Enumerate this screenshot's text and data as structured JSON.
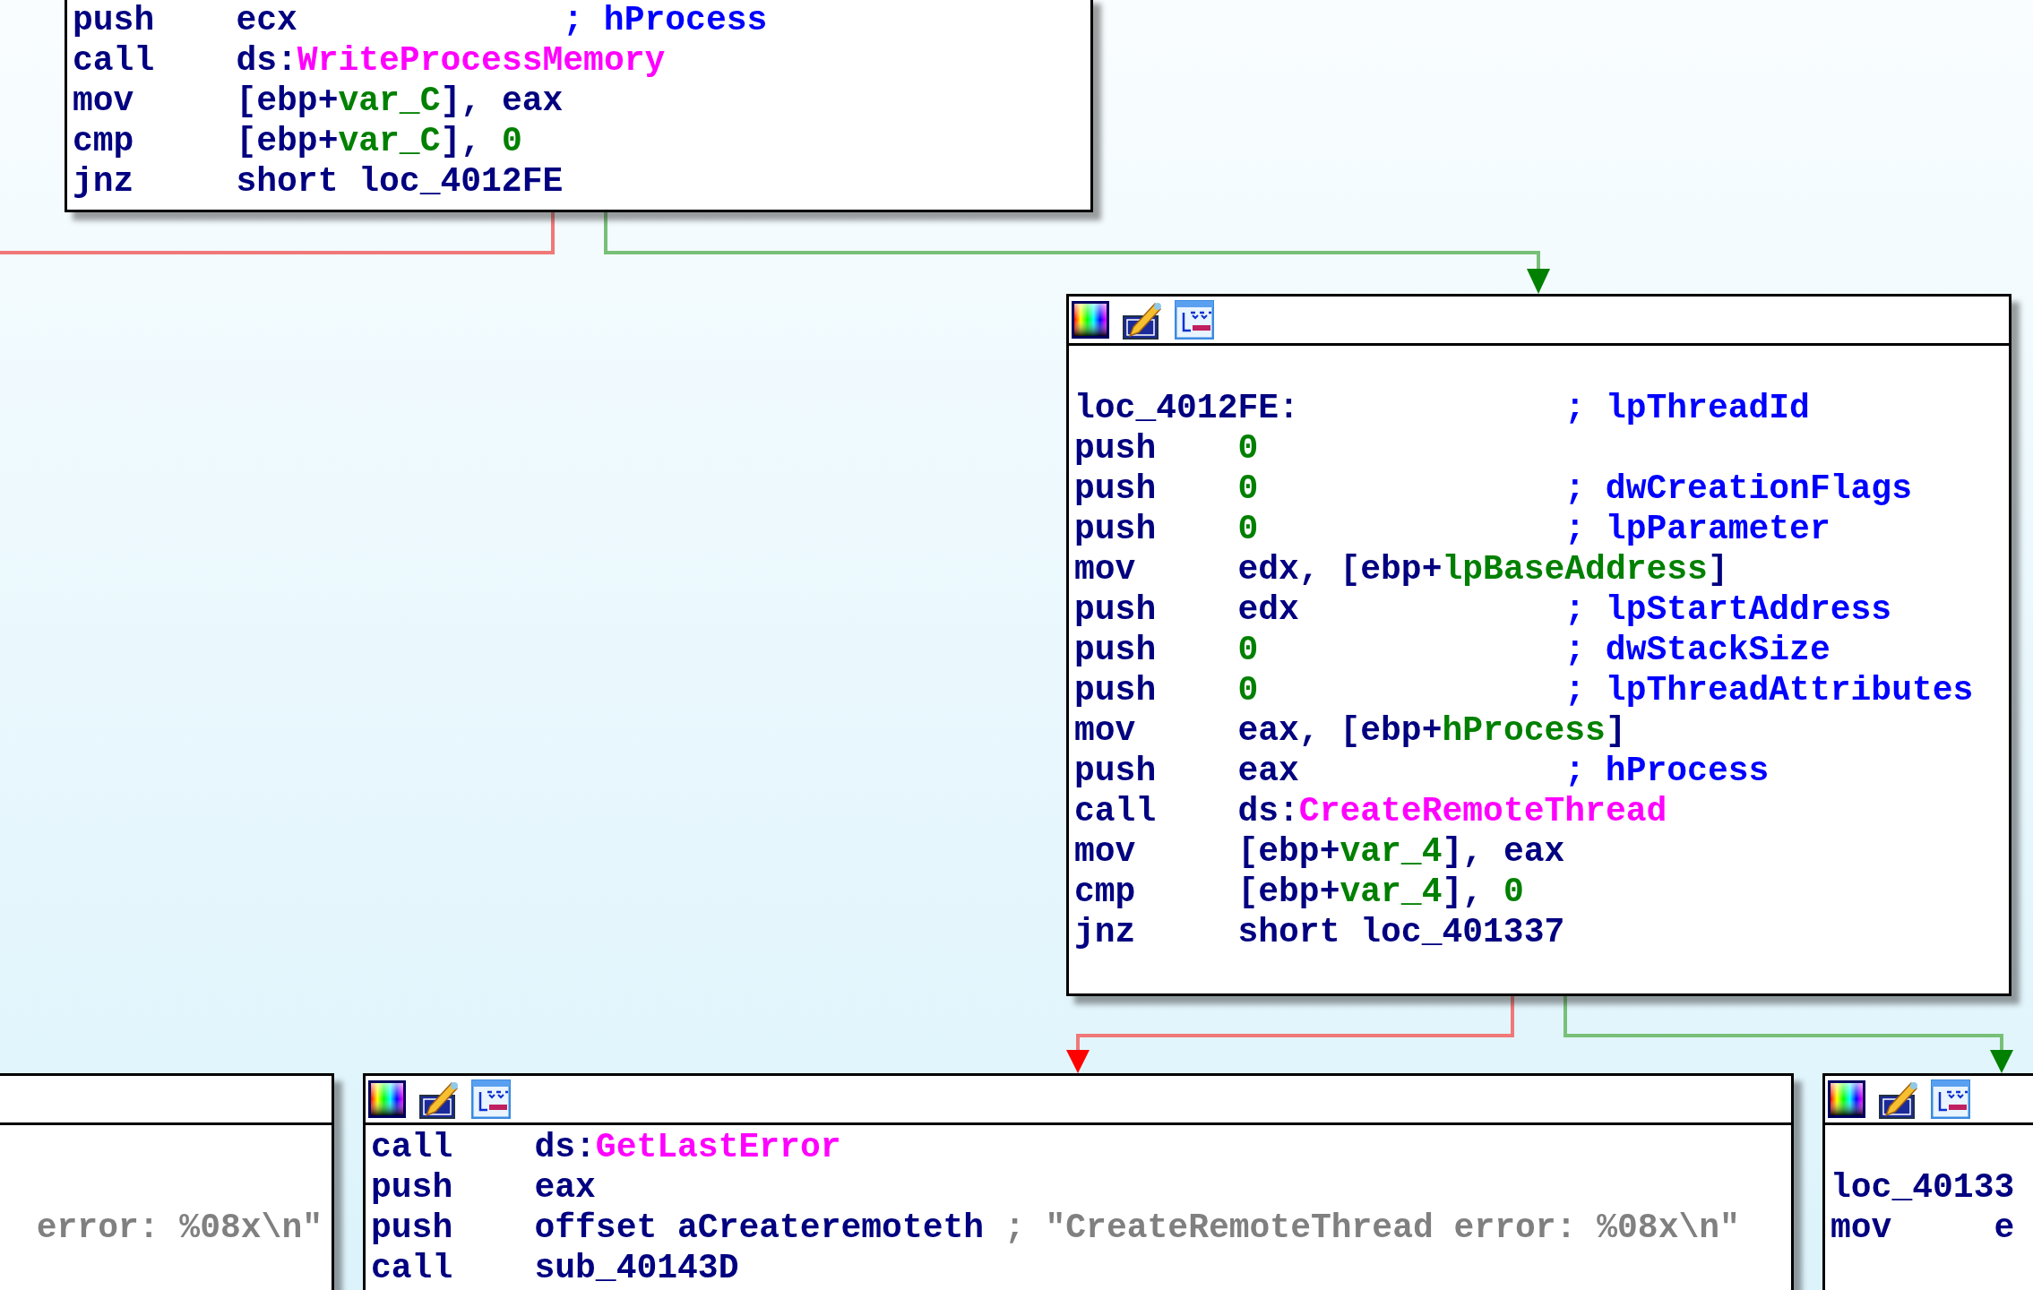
{
  "graph": {
    "blocks": [
      {
        "kind": "bare",
        "lines": [
          {
            "kind": "instr",
            "mnemonic": "push",
            "operand": [
              {
                "kind": "plain",
                "text": "ecx"
              }
            ],
            "comment": {
              "kind": "name",
              "text": "; hProcess"
            }
          },
          {
            "kind": "instr",
            "mnemonic": "call",
            "operand": [
              {
                "kind": "plain",
                "text": "ds:"
              },
              {
                "kind": "import",
                "text": "WriteProcessMemory"
              }
            ]
          },
          {
            "kind": "instr",
            "mnemonic": "mov",
            "operand": [
              {
                "kind": "plain",
                "text": "[ebp+"
              },
              {
                "kind": "var",
                "text": "var_C"
              },
              {
                "kind": "plain",
                "text": "], eax"
              }
            ]
          },
          {
            "kind": "instr",
            "mnemonic": "cmp",
            "operand": [
              {
                "kind": "plain",
                "text": "[ebp+"
              },
              {
                "kind": "var",
                "text": "var_C"
              },
              {
                "kind": "plain",
                "text": "], "
              },
              {
                "kind": "number",
                "text": "0"
              }
            ]
          },
          {
            "kind": "instr",
            "mnemonic": "jnz",
            "operand": [
              {
                "kind": "plain",
                "text": "short loc_4012FE"
              }
            ]
          }
        ]
      },
      {
        "kind": "toolbar",
        "lines": [
          {
            "kind": "blank"
          },
          {
            "kind": "label",
            "label": "loc_4012FE:",
            "comment": {
              "kind": "name",
              "text": "; lpThreadId"
            }
          },
          {
            "kind": "instr",
            "mnemonic": "push",
            "operand": [
              {
                "kind": "number",
                "text": "0"
              }
            ]
          },
          {
            "kind": "instr",
            "mnemonic": "push",
            "operand": [
              {
                "kind": "number",
                "text": "0"
              }
            ],
            "comment": {
              "kind": "name",
              "text": "; dwCreationFlags"
            }
          },
          {
            "kind": "instr",
            "mnemonic": "push",
            "operand": [
              {
                "kind": "number",
                "text": "0"
              }
            ],
            "comment": {
              "kind": "name",
              "text": "; lpParameter"
            }
          },
          {
            "kind": "instr",
            "mnemonic": "mov",
            "operand": [
              {
                "kind": "plain",
                "text": "edx, [ebp+"
              },
              {
                "kind": "var",
                "text": "lpBaseAddress"
              },
              {
                "kind": "plain",
                "text": "]"
              }
            ]
          },
          {
            "kind": "instr",
            "mnemonic": "push",
            "operand": [
              {
                "kind": "plain",
                "text": "edx"
              }
            ],
            "comment": {
              "kind": "name",
              "text": "; lpStartAddress"
            }
          },
          {
            "kind": "instr",
            "mnemonic": "push",
            "operand": [
              {
                "kind": "number",
                "text": "0"
              }
            ],
            "comment": {
              "kind": "name",
              "text": "; dwStackSize"
            }
          },
          {
            "kind": "instr",
            "mnemonic": "push",
            "operand": [
              {
                "kind": "number",
                "text": "0"
              }
            ],
            "comment": {
              "kind": "name",
              "text": "; lpThreadAttributes"
            }
          },
          {
            "kind": "instr",
            "mnemonic": "mov",
            "operand": [
              {
                "kind": "plain",
                "text": "eax, [ebp+"
              },
              {
                "kind": "var",
                "text": "hProcess"
              },
              {
                "kind": "plain",
                "text": "]"
              }
            ]
          },
          {
            "kind": "instr",
            "mnemonic": "push",
            "operand": [
              {
                "kind": "plain",
                "text": "eax"
              }
            ],
            "comment": {
              "kind": "name",
              "text": "; hProcess"
            }
          },
          {
            "kind": "instr",
            "mnemonic": "call",
            "operand": [
              {
                "kind": "plain",
                "text": "ds:"
              },
              {
                "kind": "import",
                "text": "CreateRemoteThread"
              }
            ]
          },
          {
            "kind": "instr",
            "mnemonic": "mov",
            "operand": [
              {
                "kind": "plain",
                "text": "[ebp+"
              },
              {
                "kind": "var",
                "text": "var_4"
              },
              {
                "kind": "plain",
                "text": "], eax"
              }
            ]
          },
          {
            "kind": "instr",
            "mnemonic": "cmp",
            "operand": [
              {
                "kind": "plain",
                "text": "[ebp+"
              },
              {
                "kind": "var",
                "text": "var_4"
              },
              {
                "kind": "plain",
                "text": "], "
              },
              {
                "kind": "number",
                "text": "0"
              }
            ]
          },
          {
            "kind": "instr",
            "mnemonic": "jnz",
            "operand": [
              {
                "kind": "plain",
                "text": "short loc_401337"
              }
            ]
          }
        ]
      },
      {
        "kind": "cut",
        "lines": [
          {
            "kind": "blank"
          },
          {
            "kind": "blank"
          },
          {
            "kind": "instr",
            "operand": [
              {
                "kind": "string",
                "text": "error: %08x\\n\""
              }
            ]
          }
        ]
      },
      {
        "kind": "toolbar",
        "lines": [
          {
            "kind": "instr",
            "mnemonic": "call",
            "operand": [
              {
                "kind": "plain",
                "text": "ds:"
              },
              {
                "kind": "import",
                "text": "GetLastError"
              }
            ]
          },
          {
            "kind": "instr",
            "mnemonic": "push",
            "operand": [
              {
                "kind": "plain",
                "text": "eax"
              }
            ]
          },
          {
            "kind": "instr",
            "mnemonic": "push",
            "operand": [
              {
                "kind": "plain",
                "text": "offset aCreateremoteth"
              }
            ],
            "comment": {
              "kind": "string",
              "text": "; \"CreateRemoteThread error: %08x\\n\""
            }
          },
          {
            "kind": "instr",
            "mnemonic": "call",
            "operand": [
              {
                "kind": "plain",
                "text": "sub_40143D"
              }
            ]
          }
        ]
      },
      {
        "kind": "toolbar",
        "lines": [
          {
            "kind": "blank"
          },
          {
            "kind": "label",
            "label": "loc_40133"
          },
          {
            "kind": "instr",
            "mnemonic": "mov",
            "operand": [
              {
                "kind": "plain",
                "text": "e"
              }
            ]
          }
        ]
      }
    ]
  }
}
